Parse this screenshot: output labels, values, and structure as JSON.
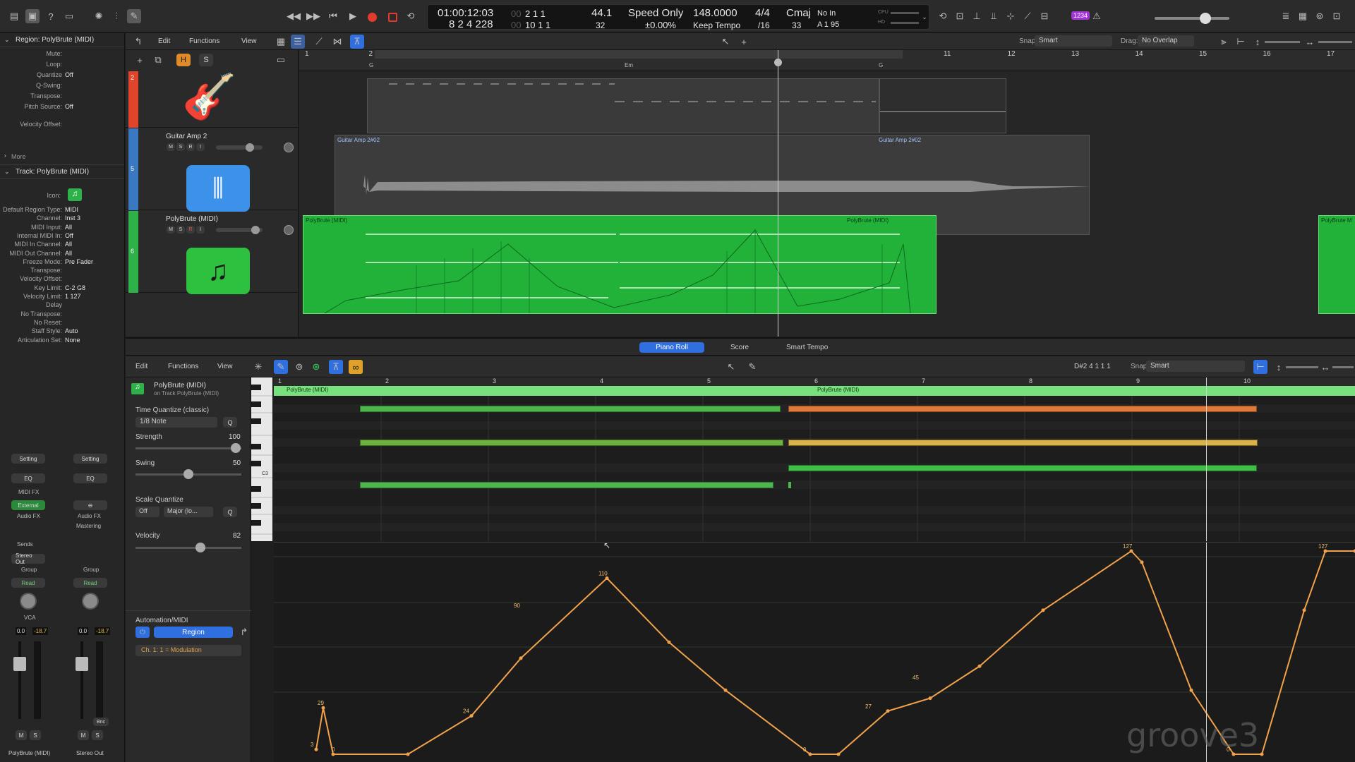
{
  "lcd": {
    "time_top": "01:00:12:03",
    "time_bottom": "8  2  4  228",
    "bars_top": "2  1  1",
    "bars_top_dim": "00",
    "bars_bottom": "10  1  1",
    "bars_bottom_dim": "00",
    "sample_top": "44.1",
    "sample_bottom": "32",
    "mode_top": "Speed Only",
    "mode_bottom": "±0.00%",
    "tempo_top": "148.0000",
    "tempo_bottom": "Keep Tempo",
    "sig_top": "4/4",
    "sig_bottom": "/16",
    "key_top": "Cmaj",
    "key_bottom": "33",
    "in_top": "No In",
    "in_bottom": "A  1  95",
    "cpu_label": "CPU",
    "hd_label": "HD",
    "badge": "1234"
  },
  "inspector": {
    "region_header": "Region: PolyBrute (MIDI)",
    "region_rows": [
      {
        "label": "Mute:",
        "value": ""
      },
      {
        "label": "Loop:",
        "value": ""
      },
      {
        "label": "Quantize",
        "value": "Off"
      },
      {
        "label": "Q-Swing:",
        "value": ""
      },
      {
        "label": "Transpose:",
        "value": ""
      },
      {
        "label": "Pitch Source:",
        "value": "Off"
      },
      {
        "label": "Velocity Offset:",
        "value": ""
      }
    ],
    "more_label": "More",
    "track_header": "Track:  PolyBrute (MIDI)",
    "icon_label": "Icon:",
    "track_rows": [
      {
        "label": "Default Region Type:",
        "value": "MIDI"
      },
      {
        "label": "Channel:",
        "value": "Inst 3"
      },
      {
        "label": "MIDI Input:",
        "value": "All"
      },
      {
        "label": "Internal MIDI In:",
        "value": "Off"
      },
      {
        "label": "MIDI In Channel:",
        "value": "All"
      },
      {
        "label": "MIDI Out Channel:",
        "value": "All"
      },
      {
        "label": "Freeze Mode:",
        "value": "Pre Fader"
      },
      {
        "label": "Transpose:",
        "value": ""
      },
      {
        "label": "Velocity Offset:",
        "value": ""
      },
      {
        "label": "Key Limit:",
        "value": "C-2  G8"
      },
      {
        "label": "Velocity Limit:",
        "value": "1  127"
      },
      {
        "label": "Delay",
        "value": ""
      },
      {
        "label": "No Transpose:",
        "value": ""
      },
      {
        "label": "No Reset:",
        "value": ""
      },
      {
        "label": "Staff Style:",
        "value": "Auto"
      },
      {
        "label": "Articulation Set:",
        "value": "None"
      }
    ]
  },
  "channel_strips": [
    {
      "setting": "Setting",
      "eq": "EQ",
      "midi_fx": "MIDI FX",
      "insert": "External",
      "audio_fx": "Audio FX",
      "sends": "Sends",
      "output": "Stereo Out",
      "group": "Group",
      "automation": "Read",
      "vca": "VCA",
      "vol": "0.0",
      "peak": "-18.7",
      "m": "M",
      "s": "S",
      "name": "PolyBrute (MIDI)"
    },
    {
      "setting": "Setting",
      "eq": "EQ",
      "midi_fx": "",
      "insert": "",
      "audio_fx": "Audio FX",
      "sends": "Mastering",
      "output": "",
      "group": "Group",
      "automation": "Read",
      "vca": "",
      "vol": "0.0",
      "peak": "-18.7",
      "m": "M",
      "s": "S",
      "bnc": "Bnc",
      "name": "Stereo Out"
    }
  ],
  "tracks_menu": {
    "edit": "Edit",
    "functions": "Functions",
    "view": "View",
    "snap_label": "Snap:",
    "snap_value": "Smart",
    "drag_label": "Drag:",
    "drag_value": "No Overlap"
  },
  "track_header_buttons": {
    "h": "H",
    "s": "S"
  },
  "ruler": [
    "1",
    "2",
    "3",
    "4",
    "5",
    "6",
    "7",
    "8",
    "9",
    "10",
    "11",
    "12",
    "13",
    "14",
    "15",
    "16",
    "17"
  ],
  "chord_markers": [
    "G",
    "Em",
    "G"
  ],
  "tracks": [
    {
      "number": "2",
      "name": "",
      "color": "#e0452c"
    },
    {
      "number": "5",
      "name": "Guitar Amp 2",
      "color": "#3a78c2",
      "m": "M",
      "s": "S",
      "r": "R",
      "i": "I"
    },
    {
      "number": "6",
      "name": "PolyBrute (MIDI)",
      "color": "#2fb14a",
      "m": "M",
      "s": "S",
      "r": "R",
      "i": "I"
    }
  ],
  "regions": {
    "audio_1": "Guitar Amp 2#02",
    "audio_2": "Guitar Amp 2#02",
    "midi_1": "PolyBrute (MIDI)",
    "midi_2": "PolyBrute (MIDI)",
    "midi_3": "PolyBrute M"
  },
  "editor_tabs": [
    "Piano Roll",
    "Score",
    "Smart Tempo"
  ],
  "editor_menu": {
    "edit": "Edit",
    "functions": "Functions",
    "view": "View",
    "position": "D#2  4 1 1 1",
    "snap_label": "Snap:",
    "snap_value": "Smart"
  },
  "editor_region": {
    "name": "PolyBrute (MIDI)",
    "subtitle": "on Track PolyBrute (MIDI)"
  },
  "quantize": {
    "title": "Time Quantize (classic)",
    "value": "1/8 Note",
    "q": "Q",
    "strength_label": "Strength",
    "strength": "100",
    "swing_label": "Swing",
    "swing": "50",
    "scale_title": "Scale Quantize",
    "scale_off": "Off",
    "scale_value": "Major (lo...",
    "velocity_label": "Velocity",
    "velocity": "82"
  },
  "piano": {
    "c3_label": "C3"
  },
  "editor_ruler": [
    "1",
    "2",
    "3",
    "4",
    "5",
    "6",
    "7",
    "8",
    "9",
    "10"
  ],
  "editor_region_labels": [
    "PolyBrute (MIDI)",
    "PolyBrute (MIDI)"
  ],
  "automation": {
    "title": "Automation/MIDI",
    "mode": "Region",
    "param": "Ch. 1: 1 = Modulation"
  },
  "auto_labels": [
    "3",
    "29",
    "0",
    "24",
    "90",
    "110",
    "0",
    "27",
    "45",
    "127",
    "0",
    "127"
  ],
  "watermark": "groove3",
  "colors": {
    "accent": "#2f6fe0",
    "midi_green": "#2ec13f",
    "note_orange": "#e07a3a",
    "note_yellow": "#d9b24a",
    "auto_orange": "#f1a24a",
    "record": "#e23b2e"
  }
}
